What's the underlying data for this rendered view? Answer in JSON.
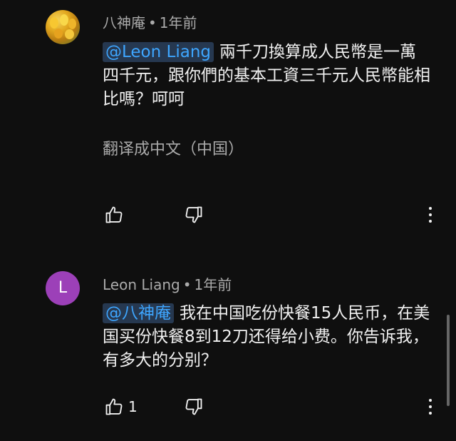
{
  "comments": [
    {
      "author": "八神庵",
      "time": "1年前",
      "mention": "@Leon Liang",
      "text": "兩千刀換算成人民幣是一萬四千元，跟你們的基本工資三千元人民幣能相比嗎？呵呵",
      "translate_label": "翻译成中文（中国）",
      "like_count": ""
    },
    {
      "author": "Leon Liang",
      "avatar_letter": "L",
      "avatar_color": "#9c40b8",
      "time": "1年前",
      "mention": "@八神庵",
      "text": "我在中国吃份快餐15人民币，在美国买份快餐8到12刀还得给小费。你告诉我，有多大的分别？",
      "like_count": "1"
    }
  ],
  "separator": "•",
  "colors": {
    "background": "#0f0f0f",
    "mention_text": "#3ea6ff",
    "mention_bg": "#263850",
    "secondary_text": "#aaaaaa"
  },
  "icons": [
    "thumbs-up-icon",
    "thumbs-down-icon",
    "more-vert-icon"
  ]
}
